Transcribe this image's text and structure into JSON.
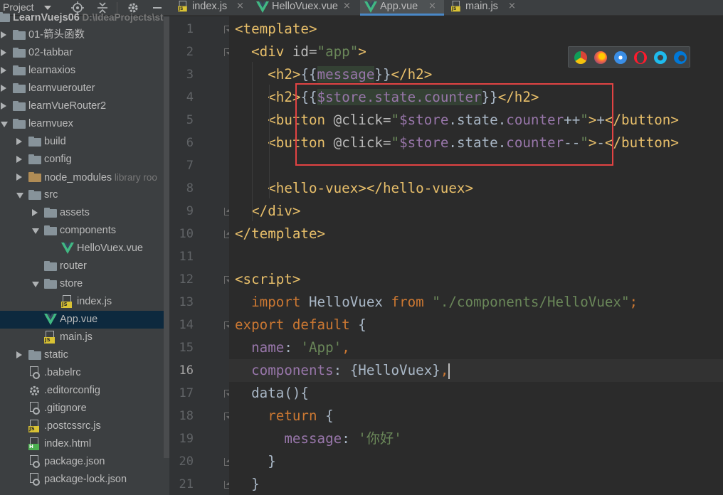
{
  "project_panel": {
    "title": "Project",
    "tree": [
      {
        "label": "LearnVuejs06",
        "hint": "D:\\IdeaProjects\\st",
        "type": "folder",
        "depth": 0,
        "state": "open"
      },
      {
        "label": "01-箭头函数",
        "type": "folder",
        "depth": 1,
        "state": "closed"
      },
      {
        "label": "02-tabbar",
        "type": "folder",
        "depth": 1,
        "state": "closed"
      },
      {
        "label": "learnaxios",
        "type": "folder",
        "depth": 1,
        "state": "closed"
      },
      {
        "label": "learnvuerouter",
        "type": "folder",
        "depth": 1,
        "state": "closed"
      },
      {
        "label": "learnVueRouter2",
        "type": "folder",
        "depth": 1,
        "state": "closed"
      },
      {
        "label": "learnvuex",
        "type": "folder",
        "depth": 1,
        "state": "open"
      },
      {
        "label": "build",
        "type": "folder",
        "depth": 2,
        "state": "closed"
      },
      {
        "label": "config",
        "type": "folder",
        "depth": 2,
        "state": "closed"
      },
      {
        "label": "node_modules",
        "hint": "library roo",
        "type": "folder-excluded",
        "depth": 2,
        "state": "closed"
      },
      {
        "label": "src",
        "type": "folder",
        "depth": 2,
        "state": "open"
      },
      {
        "label": "assets",
        "type": "folder",
        "depth": 3,
        "state": "closed"
      },
      {
        "label": "components",
        "type": "folder",
        "depth": 3,
        "state": "open"
      },
      {
        "label": "HelloVuex.vue",
        "type": "vue",
        "depth": 4,
        "state": "leaf"
      },
      {
        "label": "router",
        "type": "folder",
        "depth": 3,
        "state": "leaf"
      },
      {
        "label": "store",
        "type": "folder",
        "depth": 3,
        "state": "open"
      },
      {
        "label": "index.js",
        "type": "js",
        "depth": 4,
        "state": "leaf"
      },
      {
        "label": "App.vue",
        "type": "vue",
        "depth": 3,
        "state": "leaf",
        "selected": true
      },
      {
        "label": "main.js",
        "type": "js",
        "depth": 3,
        "state": "leaf"
      },
      {
        "label": "static",
        "type": "folder",
        "depth": 2,
        "state": "closed"
      },
      {
        "label": ".babelrc",
        "type": "config",
        "depth": 2,
        "state": "leaf"
      },
      {
        "label": ".editorconfig",
        "type": "gear",
        "depth": 2,
        "state": "leaf"
      },
      {
        "label": ".gitignore",
        "type": "config",
        "depth": 2,
        "state": "leaf"
      },
      {
        "label": ".postcssrc.js",
        "type": "js",
        "depth": 2,
        "state": "leaf"
      },
      {
        "label": "index.html",
        "type": "html",
        "depth": 2,
        "state": "leaf"
      },
      {
        "label": "package.json",
        "type": "config",
        "depth": 2,
        "state": "leaf"
      },
      {
        "label": "package-lock.json",
        "type": "config",
        "depth": 2,
        "state": "leaf"
      }
    ]
  },
  "tabs": [
    {
      "label": "index.js",
      "type": "js",
      "active": false
    },
    {
      "label": "HelloVuex.vue",
      "type": "vue",
      "active": false
    },
    {
      "label": "App.vue",
      "type": "vue",
      "active": true
    },
    {
      "label": "main.js",
      "type": "js",
      "active": false
    }
  ],
  "editor": {
    "current_line": 16,
    "lines": [
      {
        "n": "1",
        "fold": "open",
        "tokens": [
          [
            "tagc",
            "<template>"
          ]
        ]
      },
      {
        "n": "2",
        "fold": "open",
        "tokens": [
          [
            "txt",
            "  "
          ],
          [
            "tagc",
            "<div "
          ],
          [
            "attr",
            "id="
          ],
          [
            "str",
            "\"app\""
          ],
          [
            "tagc",
            ">"
          ]
        ]
      },
      {
        "n": "3",
        "tokens": [
          [
            "txt",
            "    "
          ],
          [
            "tagc",
            "<h2>"
          ],
          [
            "txt",
            "{{"
          ],
          [
            "hlprop",
            "message"
          ],
          [
            "txt",
            "}}"
          ],
          [
            "tagc",
            "</h2>"
          ]
        ]
      },
      {
        "n": "4",
        "tokens": [
          [
            "txt",
            "    "
          ],
          [
            "tagc",
            "<h2>"
          ],
          [
            "txt",
            "{{"
          ],
          [
            "hlprop",
            "$store.state.counter"
          ],
          [
            "txt",
            "}}"
          ],
          [
            "tagc",
            "</h2>"
          ]
        ]
      },
      {
        "n": "5",
        "tokens": [
          [
            "txt",
            "    "
          ],
          [
            "tagc",
            "<button "
          ],
          [
            "attr",
            "@click="
          ],
          [
            "str",
            "\""
          ],
          [
            "prop",
            "$store"
          ],
          [
            "txt",
            ".state."
          ],
          [
            "prop",
            "counter"
          ],
          [
            "txt",
            "++"
          ],
          [
            "str",
            "\""
          ],
          [
            "tagc",
            ">"
          ],
          [
            "txt",
            "+"
          ],
          [
            "tagc",
            "</button>"
          ]
        ]
      },
      {
        "n": "6",
        "tokens": [
          [
            "txt",
            "    "
          ],
          [
            "tagc",
            "<button "
          ],
          [
            "attr",
            "@click="
          ],
          [
            "str",
            "\""
          ],
          [
            "prop",
            "$store"
          ],
          [
            "txt",
            ".state."
          ],
          [
            "prop",
            "counter"
          ],
          [
            "txt",
            "--"
          ],
          [
            "str",
            "\""
          ],
          [
            "tagc",
            ">"
          ],
          [
            "txt",
            "-"
          ],
          [
            "tagc",
            "</button>"
          ]
        ]
      },
      {
        "n": "7",
        "tokens": []
      },
      {
        "n": "8",
        "tokens": [
          [
            "txt",
            "    "
          ],
          [
            "tagc",
            "<hello-vuex></hello-vuex>"
          ]
        ]
      },
      {
        "n": "9",
        "fold": "close",
        "tokens": [
          [
            "txt",
            "  "
          ],
          [
            "tagc",
            "</div>"
          ]
        ]
      },
      {
        "n": "10",
        "fold": "close",
        "tokens": [
          [
            "tagc",
            "</template>"
          ]
        ]
      },
      {
        "n": "11",
        "tokens": []
      },
      {
        "n": "12",
        "fold": "open",
        "tokens": [
          [
            "tagc",
            "<script>"
          ]
        ]
      },
      {
        "n": "13",
        "tokens": [
          [
            "txt",
            "  "
          ],
          [
            "kw",
            "import "
          ],
          [
            "txt",
            "HelloVuex "
          ],
          [
            "kw",
            "from "
          ],
          [
            "str",
            "\"./components/HelloVuex\""
          ],
          [
            "kw",
            ";"
          ]
        ]
      },
      {
        "n": "14",
        "fold": "open",
        "tokens": [
          [
            "kw",
            "export default "
          ],
          [
            "txt",
            "{"
          ]
        ]
      },
      {
        "n": "15",
        "tokens": [
          [
            "txt",
            "  "
          ],
          [
            "prop",
            "name"
          ],
          [
            "txt",
            ": "
          ],
          [
            "str",
            "'App'"
          ],
          [
            "kw",
            ","
          ]
        ]
      },
      {
        "n": "16",
        "tokens": [
          [
            "txt",
            "  "
          ],
          [
            "prop",
            "components"
          ],
          [
            "txt",
            ": {HelloVuex}"
          ],
          [
            "kw",
            ","
          ],
          [
            "cursor",
            ""
          ]
        ]
      },
      {
        "n": "17",
        "fold": "open",
        "tokens": [
          [
            "txt",
            "  "
          ],
          [
            "txt",
            "data(){"
          ]
        ]
      },
      {
        "n": "18",
        "fold": "open",
        "tokens": [
          [
            "txt",
            "    "
          ],
          [
            "kw",
            "return "
          ],
          [
            "txt",
            "{"
          ]
        ]
      },
      {
        "n": "19",
        "tokens": [
          [
            "txt",
            "      "
          ],
          [
            "prop",
            "message"
          ],
          [
            "txt",
            ": "
          ],
          [
            "str",
            "'你好'"
          ]
        ]
      },
      {
        "n": "20",
        "fold": "close",
        "tokens": [
          [
            "txt",
            "    }"
          ]
        ]
      },
      {
        "n": "21",
        "fold": "close",
        "tokens": [
          [
            "txt",
            "  }"
          ]
        ]
      }
    ]
  },
  "colors": {
    "accent": "#4a88c7",
    "highlight_box": "#e24343",
    "vue_green": "#41b883"
  },
  "browser_icons": [
    "chrome-icon",
    "firefox-icon",
    "safari-icon",
    "opera-icon",
    "ie-icon",
    "edge-icon"
  ]
}
